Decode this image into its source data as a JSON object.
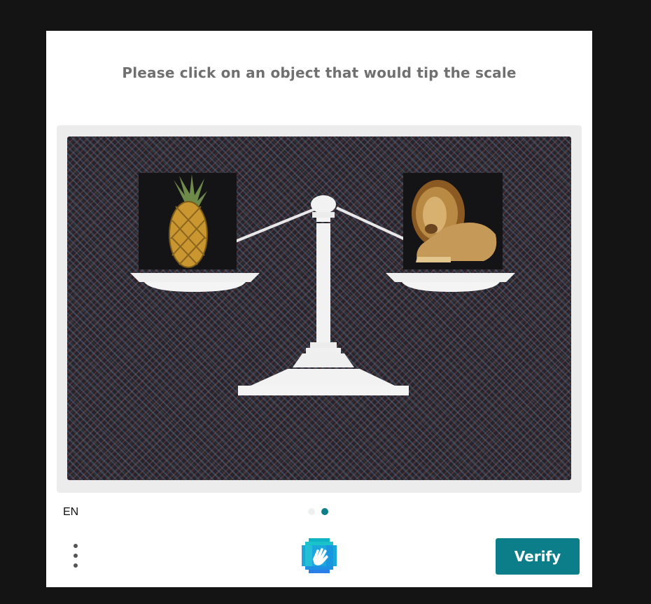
{
  "challenge": {
    "prompt": "Please click on an object that would tip the scale",
    "image": {
      "left_item": "pineapple",
      "right_item": "lion",
      "center_item": "balance scale"
    }
  },
  "footer": {
    "language": "EN",
    "pagination": {
      "pages": 2,
      "current": 2
    },
    "menu_icon": "more-vertical-icon",
    "logo_icon": "hcaptcha-logo",
    "verify_label": "Verify"
  },
  "colors": {
    "accent": "#0b7e89",
    "prompt_text": "#707070",
    "background": "#141414",
    "dialog": "#ffffff"
  }
}
